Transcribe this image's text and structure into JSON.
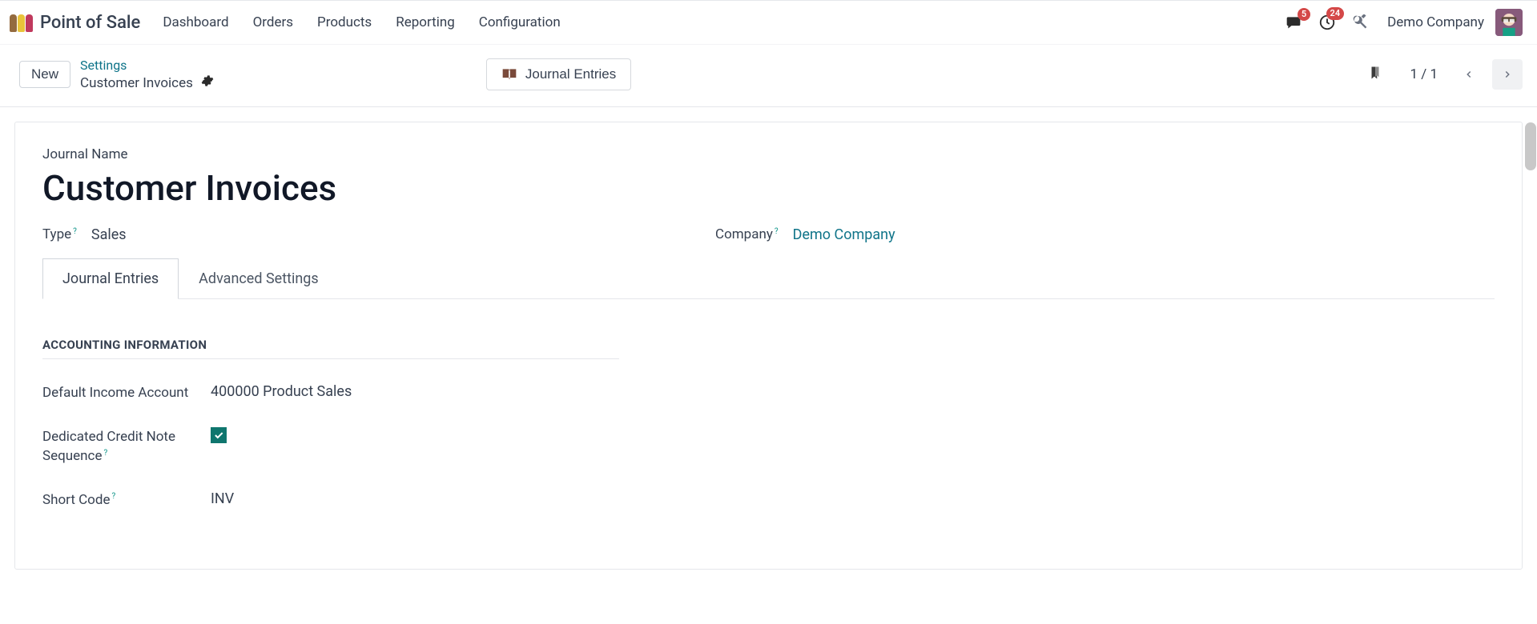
{
  "app": {
    "title": "Point of Sale"
  },
  "nav": [
    "Dashboard",
    "Orders",
    "Products",
    "Reporting",
    "Configuration"
  ],
  "top": {
    "msgBadge": "5",
    "clockBadge": "24",
    "company": "Demo Company"
  },
  "control": {
    "newLabel": "New",
    "breadcrumbLink": "Settings",
    "breadcrumbCurrent": "Customer Invoices",
    "journalBtn": "Journal Entries",
    "pager": "1 / 1"
  },
  "sheet": {
    "journalNameLabel": "Journal Name",
    "journalName": "Customer Invoices",
    "typeLabel": "Type",
    "typeValue": "Sales",
    "companyLabel": "Company",
    "companyValue": "Demo Company",
    "tabs": {
      "entries": "Journal Entries",
      "advanced": "Advanced Settings"
    },
    "section": "ACCOUNTING INFORMATION",
    "rows": {
      "incomeLabel": "Default Income Account",
      "incomeValue": "400000 Product Sales",
      "dedicatedLabel": "Dedicated Credit Note Sequence",
      "shortCodeLabel": "Short Code",
      "shortCodeValue": "INV"
    }
  }
}
